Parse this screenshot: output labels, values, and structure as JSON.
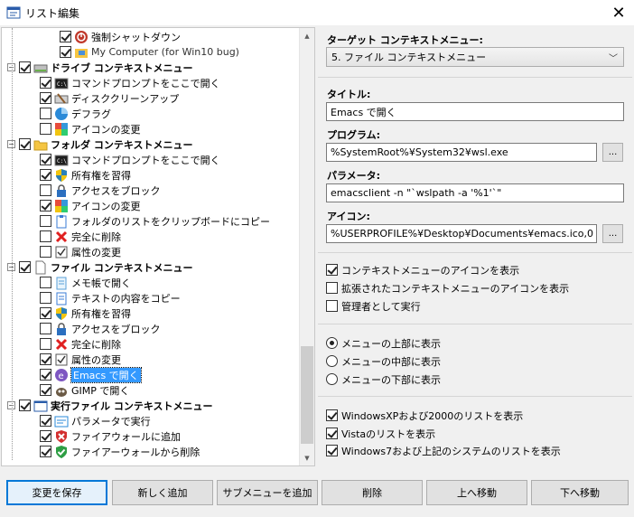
{
  "window": {
    "title": "リスト編集",
    "close_glyph": "✕"
  },
  "tree": {
    "items": [
      {
        "label": "強制シャットダウン",
        "checked": true,
        "icon": "shutdown-icon",
        "level": 3,
        "expander": "",
        "bold": false
      },
      {
        "label": "My Computer (for Win10 bug)",
        "checked": true,
        "icon": "folder-computer-icon",
        "level": 3,
        "expander": "",
        "bold": false
      },
      {
        "label": "ドライブ コンテキストメニュー",
        "checked": true,
        "icon": "drive-icon",
        "level": 1,
        "expander": "−",
        "bold": true
      },
      {
        "label": "コマンドプロンプトをここで開く",
        "checked": true,
        "icon": "cmd-icon",
        "level": 2,
        "expander": "",
        "bold": false
      },
      {
        "label": "ディスククリーンアップ",
        "checked": true,
        "icon": "disk-cleanup-icon",
        "level": 2,
        "expander": "",
        "bold": false
      },
      {
        "label": "デフラグ",
        "checked": false,
        "icon": "defrag-icon",
        "level": 2,
        "expander": "",
        "bold": false
      },
      {
        "label": "アイコンの変更",
        "checked": false,
        "icon": "change-icon-icon",
        "level": 2,
        "expander": "",
        "bold": false
      },
      {
        "label": "フォルダ コンテキストメニュー",
        "checked": true,
        "icon": "folder-icon",
        "level": 1,
        "expander": "−",
        "bold": true
      },
      {
        "label": "コマンドプロンプトをここで開く",
        "checked": true,
        "icon": "cmd-icon",
        "level": 2,
        "expander": "",
        "bold": false
      },
      {
        "label": "所有権を習得",
        "checked": true,
        "icon": "shield-icon",
        "level": 2,
        "expander": "",
        "bold": false
      },
      {
        "label": "アクセスをブロック",
        "checked": false,
        "icon": "lock-icon",
        "level": 2,
        "expander": "",
        "bold": false
      },
      {
        "label": "アイコンの変更",
        "checked": true,
        "icon": "change-icon-icon",
        "level": 2,
        "expander": "",
        "bold": false
      },
      {
        "label": "フォルダのリストをクリップボードにコピー",
        "checked": false,
        "icon": "clipboard-icon",
        "level": 2,
        "expander": "",
        "bold": false
      },
      {
        "label": "完全に削除",
        "checked": false,
        "icon": "delete-x-icon",
        "level": 2,
        "expander": "",
        "bold": false
      },
      {
        "label": "属性の変更",
        "checked": false,
        "icon": "attributes-icon",
        "level": 2,
        "expander": "",
        "bold": false
      },
      {
        "label": "ファイル コンテキストメニュー",
        "checked": true,
        "icon": "file-icon",
        "level": 1,
        "expander": "−",
        "bold": true
      },
      {
        "label": "メモ帳で開く",
        "checked": false,
        "icon": "notepad-icon",
        "level": 2,
        "expander": "",
        "bold": false
      },
      {
        "label": "テキストの内容をコピー",
        "checked": false,
        "icon": "copy-text-icon",
        "level": 2,
        "expander": "",
        "bold": false
      },
      {
        "label": "所有権を習得",
        "checked": true,
        "icon": "shield-icon",
        "level": 2,
        "expander": "",
        "bold": false
      },
      {
        "label": "アクセスをブロック",
        "checked": false,
        "icon": "lock-icon",
        "level": 2,
        "expander": "",
        "bold": false
      },
      {
        "label": "完全に削除",
        "checked": false,
        "icon": "delete-x-icon",
        "level": 2,
        "expander": "",
        "bold": false
      },
      {
        "label": "属性の変更",
        "checked": true,
        "icon": "attributes-icon",
        "level": 2,
        "expander": "",
        "bold": false
      },
      {
        "label": "Emacs で開く",
        "checked": true,
        "icon": "emacs-icon",
        "level": 2,
        "expander": "",
        "bold": false,
        "selected": true
      },
      {
        "label": "GIMP で開く",
        "checked": true,
        "icon": "gimp-icon",
        "level": 2,
        "expander": "",
        "bold": false
      },
      {
        "label": "実行ファイル コンテキストメニュー",
        "checked": true,
        "icon": "window-icon",
        "level": 1,
        "expander": "−",
        "bold": true
      },
      {
        "label": "パラメータで実行",
        "checked": true,
        "icon": "params-icon",
        "level": 2,
        "expander": "",
        "bold": false
      },
      {
        "label": "ファイアウォールに追加",
        "checked": true,
        "icon": "firewall-add-icon",
        "level": 2,
        "expander": "",
        "bold": false
      },
      {
        "label": "ファイアーウォールから削除",
        "checked": true,
        "icon": "firewall-remove-icon",
        "level": 2,
        "expander": "",
        "bold": false
      }
    ]
  },
  "target": {
    "label": "ターゲット コンテキストメニュー:",
    "value": "5. ファイル コンテキストメニュー"
  },
  "title_field": {
    "label": "タイトル:",
    "value": "Emacs で開く"
  },
  "program_field": {
    "label": "プログラム:",
    "value": "%SystemRoot%¥System32¥wsl.exe",
    "browse": "..."
  },
  "params_field": {
    "label": "パラメータ:",
    "value": "emacsclient -n \"`wslpath -a '%1'`\""
  },
  "icon_field": {
    "label": "アイコン:",
    "value": "%USERPROFILE%¥Desktop¥Documents¥emacs.ico,0",
    "browse": "..."
  },
  "options": [
    {
      "label": "コンテキストメニューのアイコンを表示",
      "checked": true
    },
    {
      "label": "拡張されたコンテキストメニューのアイコンを表示",
      "checked": false
    },
    {
      "label": "管理者として実行",
      "checked": false
    }
  ],
  "position": [
    {
      "label": "メニューの上部に表示",
      "selected": true
    },
    {
      "label": "メニューの中部に表示",
      "selected": false
    },
    {
      "label": "メニューの下部に表示",
      "selected": false
    }
  ],
  "os_options": [
    {
      "label": "WindowsXPおよび2000のリストを表示",
      "checked": true
    },
    {
      "label": "Vistaのリストを表示",
      "checked": true
    },
    {
      "label": "Windows7および上記のシステムのリストを表示",
      "checked": true
    }
  ],
  "buttons": {
    "save": "変更を保存",
    "add_new": "新しく追加",
    "add_submenu": "サブメニューを追加",
    "delete": "削除",
    "move_up": "上へ移動",
    "move_down": "下へ移動"
  },
  "colors": {
    "accent": "#0078d7",
    "selection": "#3399ff"
  }
}
